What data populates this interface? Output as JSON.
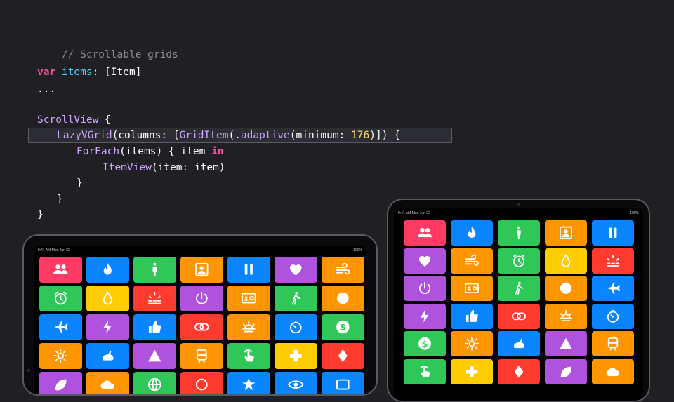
{
  "code": {
    "comment": "// Scrollable grids",
    "l2_kw": "var",
    "l2_id": "items",
    "l2_rest_a": ": [",
    "l2_ty": "Item",
    "l2_rest_b": "]",
    "l3": "...",
    "l5_ty": "ScrollView",
    "l5_rest": " {",
    "l6_ty": "LazyVGrid",
    "l6_a": "(columns: [",
    "l6_ty2": "GridItem",
    "l6_b": "(.",
    "l6_fn": "adaptive",
    "l6_c": "(minimum: ",
    "l6_num": "176",
    "l6_d": ")]) {",
    "l7_ty": "ForEach",
    "l7_a": "(items) { item ",
    "l7_kw": "in",
    "l8_ty": "ItemView",
    "l8_a": "(item: item)",
    "close": "}"
  },
  "devices": {
    "left": {
      "time": "9:41 AM  Mon Jun 22",
      "battery": "100%"
    },
    "right": {
      "time": "9:41 AM  Mon Jun 22",
      "battery": "100%"
    }
  },
  "colors": {
    "pink": "#ff3b63",
    "blue": "#0a84ff",
    "green": "#30c759",
    "orange": "#ff9500",
    "purple": "#af52de",
    "yellow": "#ffcc00",
    "red": "#ff3b30"
  },
  "left_tiles": [
    {
      "color": "pink",
      "icon": "people-icon"
    },
    {
      "color": "blue",
      "icon": "flame-icon"
    },
    {
      "color": "green",
      "icon": "figure-stand-icon"
    },
    {
      "color": "orange",
      "icon": "person-square-icon"
    },
    {
      "color": "blue",
      "icon": "pause-icon"
    },
    {
      "color": "purple",
      "icon": "heart-icon"
    },
    {
      "color": "orange",
      "icon": "wind-icon"
    },
    {
      "color": "green",
      "icon": "alarm-icon"
    },
    {
      "color": "yellow",
      "icon": "drop-icon"
    },
    {
      "color": "red",
      "icon": "sunrise-icon"
    },
    {
      "color": "purple",
      "icon": "power-icon"
    },
    {
      "color": "orange",
      "icon": "contact-card-icon"
    },
    {
      "color": "green",
      "icon": "figure-walk-icon"
    },
    {
      "color": "orange",
      "icon": "circle-icon"
    },
    {
      "color": "blue",
      "icon": "airplane-icon"
    },
    {
      "color": "purple",
      "icon": "bolt-icon"
    },
    {
      "color": "blue",
      "icon": "thumbs-up-icon"
    },
    {
      "color": "red",
      "icon": "link-icon"
    },
    {
      "color": "orange",
      "icon": "sunset-icon"
    },
    {
      "color": "blue",
      "icon": "timer-icon"
    },
    {
      "color": "green",
      "icon": "dollar-icon"
    },
    {
      "color": "orange",
      "icon": "sun-icon"
    },
    {
      "color": "blue",
      "icon": "hare-icon"
    },
    {
      "color": "purple",
      "icon": "triangle-icon"
    },
    {
      "color": "orange",
      "icon": "tram-icon"
    },
    {
      "color": "green",
      "icon": "hand-tap-icon"
    },
    {
      "color": "yellow",
      "icon": "plus-icon"
    },
    {
      "color": "red",
      "icon": "diamond-icon"
    },
    {
      "color": "purple",
      "icon": "leaf-icon"
    },
    {
      "color": "orange",
      "icon": "cloud-icon"
    },
    {
      "color": "green",
      "icon": "globe-icon"
    },
    {
      "color": "red",
      "icon": "ring-icon"
    },
    {
      "color": "blue",
      "icon": "star-icon"
    },
    {
      "color": "blue",
      "icon": "eye-icon"
    },
    {
      "color": "blue",
      "icon": "rect-icon"
    }
  ],
  "right_tiles": [
    {
      "color": "pink",
      "icon": "people-icon"
    },
    {
      "color": "blue",
      "icon": "flame-icon"
    },
    {
      "color": "green",
      "icon": "figure-stand-icon"
    },
    {
      "color": "orange",
      "icon": "person-square-icon"
    },
    {
      "color": "blue",
      "icon": "pause-icon"
    },
    {
      "color": "purple",
      "icon": "heart-icon"
    },
    {
      "color": "orange",
      "icon": "wind-icon"
    },
    {
      "color": "green",
      "icon": "alarm-icon"
    },
    {
      "color": "yellow",
      "icon": "drop-icon"
    },
    {
      "color": "red",
      "icon": "sunrise-icon"
    },
    {
      "color": "purple",
      "icon": "power-icon"
    },
    {
      "color": "orange",
      "icon": "contact-card-icon"
    },
    {
      "color": "green",
      "icon": "figure-walk-icon"
    },
    {
      "color": "orange",
      "icon": "circle-icon"
    },
    {
      "color": "blue",
      "icon": "airplane-icon"
    },
    {
      "color": "purple",
      "icon": "bolt-icon"
    },
    {
      "color": "blue",
      "icon": "thumbs-up-icon"
    },
    {
      "color": "red",
      "icon": "link-icon"
    },
    {
      "color": "orange",
      "icon": "sunset-icon"
    },
    {
      "color": "blue",
      "icon": "timer-icon"
    },
    {
      "color": "green",
      "icon": "dollar-icon"
    },
    {
      "color": "orange",
      "icon": "sun-icon"
    },
    {
      "color": "blue",
      "icon": "hare-icon"
    },
    {
      "color": "purple",
      "icon": "triangle-icon"
    },
    {
      "color": "orange",
      "icon": "tram-icon"
    },
    {
      "color": "green",
      "icon": "hand-tap-icon"
    },
    {
      "color": "yellow",
      "icon": "plus-icon"
    },
    {
      "color": "red",
      "icon": "diamond-icon"
    },
    {
      "color": "purple",
      "icon": "leaf-icon"
    },
    {
      "color": "orange",
      "icon": "cloud-icon"
    }
  ]
}
